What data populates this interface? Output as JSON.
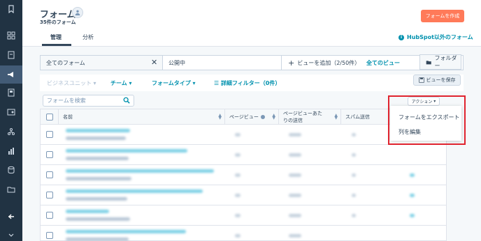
{
  "page": {
    "title": "フォーム",
    "subtitle": "35件のフォーム",
    "create_button": "フォームを作成",
    "hubspot_link": "HubSpot以外のフォーム"
  },
  "tabs": [
    {
      "label": "管理"
    },
    {
      "label": "分析"
    }
  ],
  "views": {
    "all": "全てのフォーム",
    "published": "公開中",
    "add_view": "ビューを追加（2/50件）",
    "all_views": "全てのビュー",
    "folder": "フォルダー"
  },
  "filters": {
    "business_unit": "ビジネスユニット",
    "team": "チーム",
    "form_type": "フォームタイプ",
    "advanced": "詳細フィルター（0件）",
    "save_view": "ビューを保存"
  },
  "search": {
    "placeholder": "フォームを検索"
  },
  "actions": {
    "label": "アクション",
    "menu": [
      "フォームをエクスポート",
      "列を編集"
    ]
  },
  "table": {
    "columns": [
      "名前",
      "ページビュー",
      "ページビューあたりの送信",
      "スパム送信"
    ]
  },
  "colors": {
    "accent": "#ff7a59",
    "link": "#0091ae",
    "sidebar": "#213343",
    "highlight": "#e0232e"
  }
}
